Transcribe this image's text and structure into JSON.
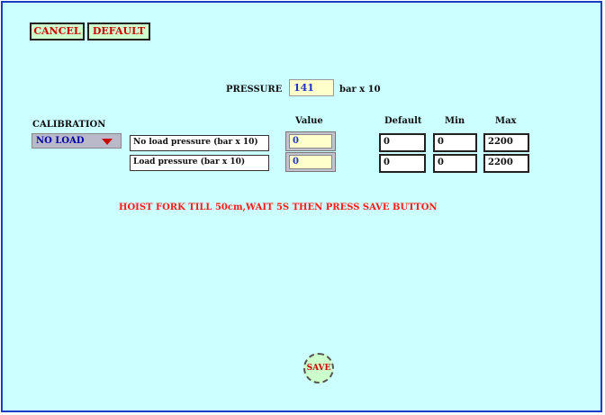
{
  "toolbar": {
    "cancel_label": "CANCEL",
    "default_label": "DEFAULT"
  },
  "pressure": {
    "label": "PRESSURE",
    "value": "141",
    "unit": "bar x 10"
  },
  "calibration": {
    "label": "CALIBRATION",
    "selected": "NO LOAD"
  },
  "table": {
    "headers": {
      "value": "Value",
      "default": "Default",
      "min": "Min",
      "max": "Max"
    },
    "rows": [
      {
        "label": "No load pressure (bar x 10)",
        "value": "0",
        "default": "0",
        "min": "0",
        "max": "2200"
      },
      {
        "label": "Load pressure  (bar x 10)",
        "value": "0",
        "default": "0",
        "min": "0",
        "max": "2200"
      }
    ]
  },
  "instruction": "HOIST FORK TILL 50cm,WAIT 5S THEN PRESS SAVE BUTTON",
  "save_label": "SAVE",
  "colors": {
    "background": "#ccffff",
    "border": "#1a3cc8",
    "accent_red": "#ff1a1a",
    "value_blue": "#2233cc"
  }
}
